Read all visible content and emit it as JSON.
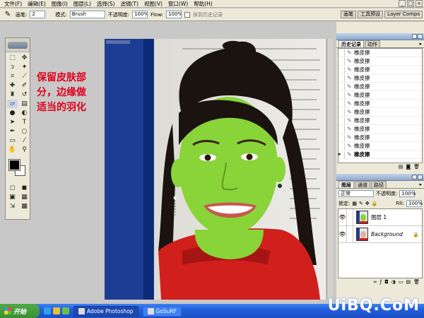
{
  "menubar": {
    "items": [
      "文件(F)",
      "编辑(E)",
      "图像(I)",
      "图层(L)",
      "选择(S)",
      "滤镜(T)",
      "视图(V)",
      "窗口(W)",
      "帮助(H)"
    ],
    "window_controls": [
      "_",
      "□",
      "×"
    ]
  },
  "options_bar": {
    "brush_label": "画笔:",
    "brush_size": "2",
    "mode_label": "模式:",
    "mode_value": "Brush",
    "opacity_label": "不透明度:",
    "opacity_value": "100%",
    "flow_label": "Flow:",
    "flow_value": "100%",
    "erase_history_label": "抹到历史记录",
    "dock_tabs": [
      "画笔",
      "工具预设",
      "Layer Comps"
    ]
  },
  "annotation": {
    "lines": [
      "保留皮肤部",
      "分，边缘做",
      "适当的羽化"
    ],
    "color": "#e0001a"
  },
  "history_panel": {
    "tabs": [
      "历史记录",
      "动作"
    ],
    "items": [
      "橡皮擦",
      "橡皮擦",
      "橡皮擦",
      "橡皮擦",
      "橡皮擦",
      "橡皮擦",
      "橡皮擦",
      "橡皮擦",
      "橡皮擦",
      "橡皮擦",
      "橡皮擦",
      "橡皮擦",
      "橡皮擦"
    ],
    "active_index": 12
  },
  "layers_panel": {
    "tabs": [
      "图层",
      "通道",
      "路径"
    ],
    "blend_mode": "正常",
    "opacity_label": "不透明度:",
    "opacity_value": "100%",
    "lock_label": "锁定:",
    "fill_label": "Fill:",
    "fill_value": "100%",
    "layers": [
      {
        "name": "图层 1",
        "selected": true
      },
      {
        "name": "Background",
        "locked": true
      }
    ]
  },
  "taskbar": {
    "start_label": "开始",
    "tasks": [
      {
        "label": "Adobe Photoshop",
        "active": true
      },
      {
        "label": "GoSuRF",
        "active": false
      }
    ]
  },
  "watermark": "UiBQ.CoM",
  "colors": {
    "skin_mask": "#88d439",
    "sweater": "#d11f1c",
    "toolbar_bg": "#ece9d8",
    "taskbar_blue": "#245edb"
  }
}
